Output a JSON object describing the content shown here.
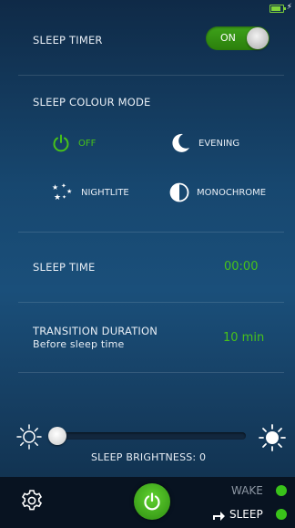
{
  "toolbar": {},
  "sleep_timer": {
    "label": "SLEEP TIMER",
    "toggle_label": "ON"
  },
  "colour_mode": {
    "title": "SLEEP COLOUR MODE",
    "options": [
      {
        "label": "OFF",
        "icon": "power-icon",
        "active": true
      },
      {
        "label": "EVENING",
        "icon": "moon-icon",
        "active": false
      },
      {
        "label": "NIGHTLITE",
        "icon": "stars-icon",
        "active": false
      },
      {
        "label": "MONOCHROME",
        "icon": "half-circle-icon",
        "active": false
      }
    ]
  },
  "sleep_time": {
    "label": "SLEEP TIME",
    "value": "00:00"
  },
  "transition": {
    "label": "TRANSITION DURATION",
    "sublabel": "Before sleep time",
    "value": "10 min"
  },
  "brightness": {
    "label": "SLEEP BRIGHTNESS: 0",
    "level": 0
  },
  "bottom": {
    "wake_label": "WAKE",
    "sleep_label": "SLEEP"
  },
  "colors": {
    "accent": "#48c21a",
    "background": "#1a4f7a"
  }
}
